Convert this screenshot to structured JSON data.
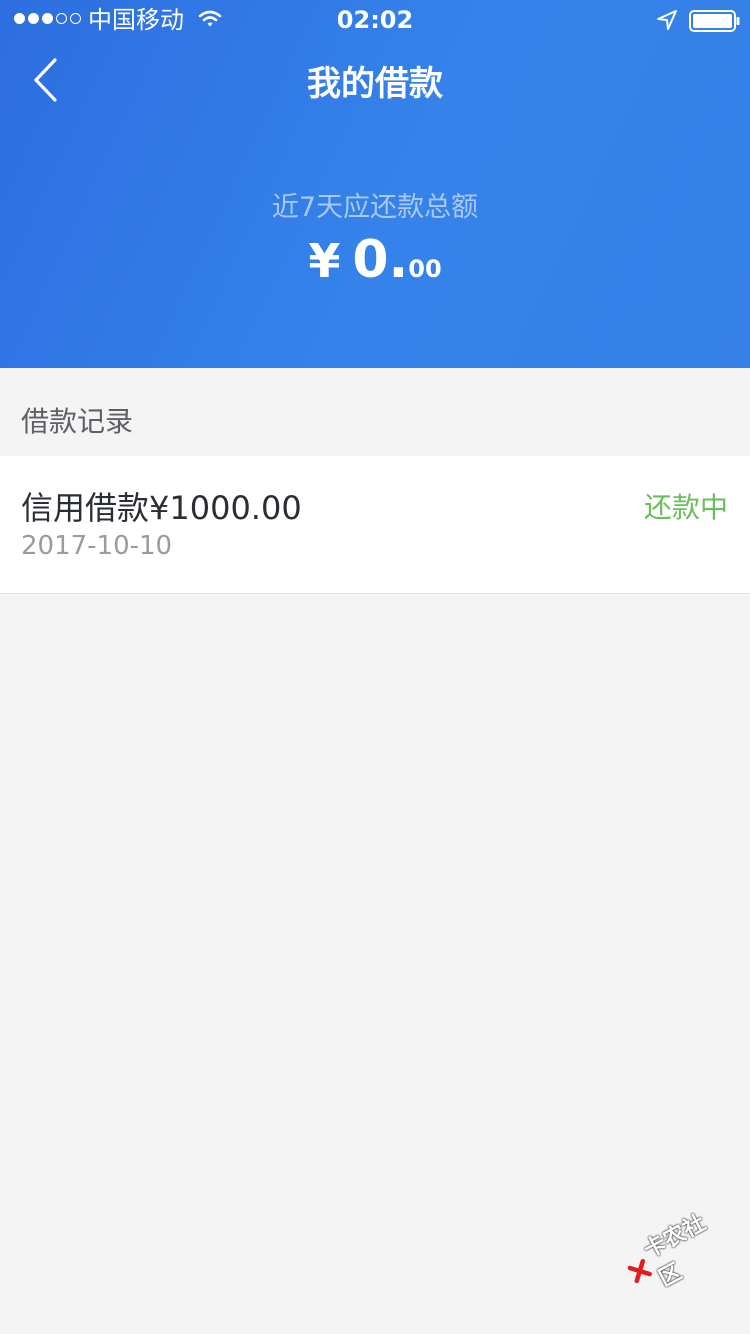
{
  "status_bar": {
    "carrier": "中国移动",
    "time": "02:02",
    "signal_dots": [
      true,
      true,
      true,
      false,
      false
    ]
  },
  "nav": {
    "title": "我的借款",
    "back_icon": "chevron-left-icon"
  },
  "summary": {
    "label": "近7天应还款总额",
    "currency": "¥",
    "amount_int": "0.",
    "amount_dec": "00"
  },
  "records": {
    "section_title": "借款记录",
    "items": [
      {
        "title": "信用借款¥1000.00",
        "date": "2017-10-10",
        "status": "还款中"
      }
    ]
  },
  "watermark": {
    "text": "卡农社区"
  },
  "colors": {
    "header_blue": "#3583ea",
    "status_green": "#6abf58",
    "background": "#f4f4f5"
  }
}
